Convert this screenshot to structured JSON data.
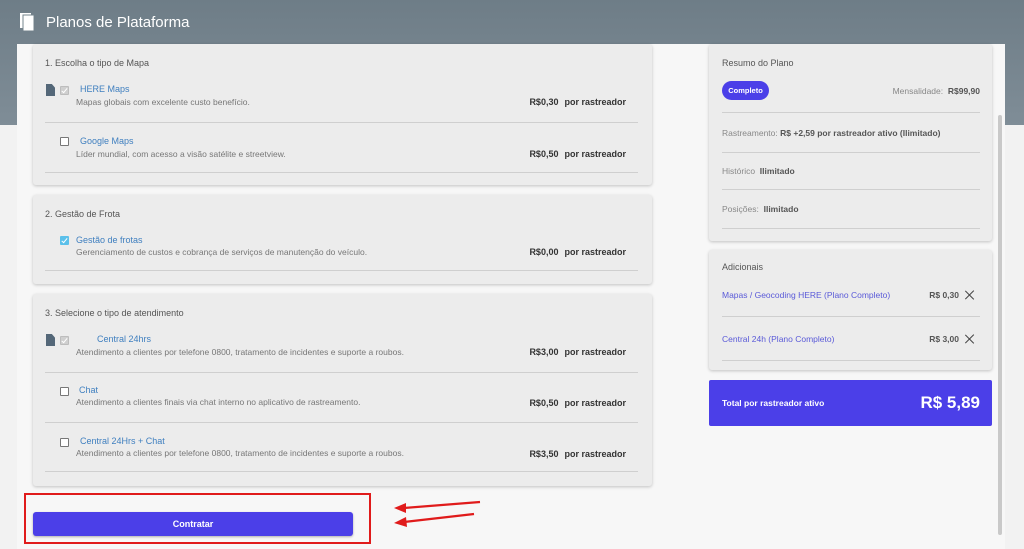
{
  "header": {
    "title": "Planos de Plataforma"
  },
  "map_section": {
    "title": "1. Escolha o tipo de Mapa",
    "options": [
      {
        "name": "HERE Maps",
        "desc": "Mapas globais com excelente custo benefício.",
        "price": "R$0,30",
        "unit": "por rastreador",
        "checked": true
      },
      {
        "name": "Google Maps",
        "desc": "Líder mundial, com acesso a visão satélite e streetview.",
        "price": "R$0,50",
        "unit": "por rastreador",
        "checked": false
      }
    ]
  },
  "fleet_section": {
    "title": "2. Gestão de Frota",
    "options": [
      {
        "name": "Gestão de frotas",
        "desc": "Gerenciamento de custos e cobrança de serviços de manutenção do veículo.",
        "price": "R$0,00",
        "unit": "por rastreador",
        "checked": true
      }
    ]
  },
  "service_section": {
    "title": "3. Selecione o tipo de atendimento",
    "options": [
      {
        "name": "Central 24hrs",
        "desc": "Atendimento a clientes por telefone 0800, tratamento de incidentes e suporte a roubos.",
        "price": "R$3,00",
        "unit": "por rastreador",
        "checked": true
      },
      {
        "name": "Chat",
        "desc": "Atendimento a clientes finais via chat interno no aplicativo de rastreamento.",
        "price": "R$0,50",
        "unit": "por rastreador",
        "checked": false
      },
      {
        "name": "Central 24Hrs + Chat",
        "desc": "Atendimento a clientes por telefone 0800, tratamento de incidentes e suporte a roubos.",
        "price": "R$3,50",
        "unit": "por rastreador",
        "checked": false
      }
    ]
  },
  "summary": {
    "title": "Resumo do Plano",
    "badge": "Completo",
    "monthly_label": "Mensalidade:",
    "monthly_value": "R$99,90",
    "tracking_label": "Rastreamento:",
    "tracking_value": "R$  +2,59 por rastreador ativo (Ilimitado)",
    "history_label": "Histórico",
    "history_value": "Ilimitado",
    "positions_label": "Posições:",
    "positions_value": "Ilimitado"
  },
  "addons": {
    "title": "Adicionais",
    "items": [
      {
        "label": "Mapas / Geocoding HERE (Plano Completo)",
        "price": "R$ 0,30"
      },
      {
        "label": "Central 24h (Plano Completo)",
        "price": "R$ 3,00"
      }
    ]
  },
  "total": {
    "label": "Total por rastreador ativo",
    "value": "R$ 5,89"
  },
  "actions": {
    "submit_label": "Contratar"
  },
  "colors": {
    "accent": "#4b3fe8",
    "header": "#76848e",
    "highlight": "#e01b1b",
    "check_blue": "#5bc0ea"
  }
}
